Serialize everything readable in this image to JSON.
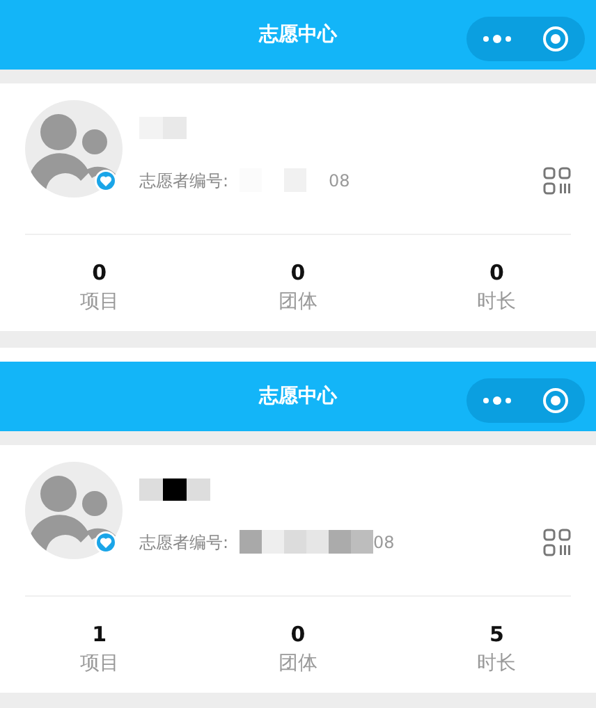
{
  "panels": [
    {
      "header": {
        "title": "志愿中心"
      },
      "profile": {
        "name_tiles": [
          {
            "color": "#f3f3f3"
          },
          {
            "color": "#e9e9e9"
          }
        ],
        "id_label": "志愿者编号:",
        "id_tiles": [
          {
            "color": "#fbfbfb"
          },
          {
            "color": "#ffffff"
          },
          {
            "color": "#f1f1f1"
          },
          {
            "color": "#ffffff"
          }
        ],
        "id_suffix": "08"
      },
      "stats": [
        {
          "value": "0",
          "label": "项目"
        },
        {
          "value": "0",
          "label": "团体"
        },
        {
          "value": "0",
          "label": "时长"
        }
      ]
    },
    {
      "header": {
        "title": "志愿中心"
      },
      "profile": {
        "name_tiles": [
          {
            "color": "#dddddd"
          },
          {
            "color": "#000000"
          },
          {
            "color": "#dddddd"
          }
        ],
        "id_label": "志愿者编号:",
        "id_tiles": [
          {
            "color": "#a9a9a9"
          },
          {
            "color": "#eeeeee"
          },
          {
            "color": "#dcdcdc"
          },
          {
            "color": "#e6e6e6"
          },
          {
            "color": "#ababab"
          },
          {
            "color": "#bdbdbd"
          }
        ],
        "id_suffix": "08"
      },
      "stats": [
        {
          "value": "1",
          "label": "项目"
        },
        {
          "value": "0",
          "label": "团体"
        },
        {
          "value": "5",
          "label": "时长"
        }
      ]
    }
  ]
}
